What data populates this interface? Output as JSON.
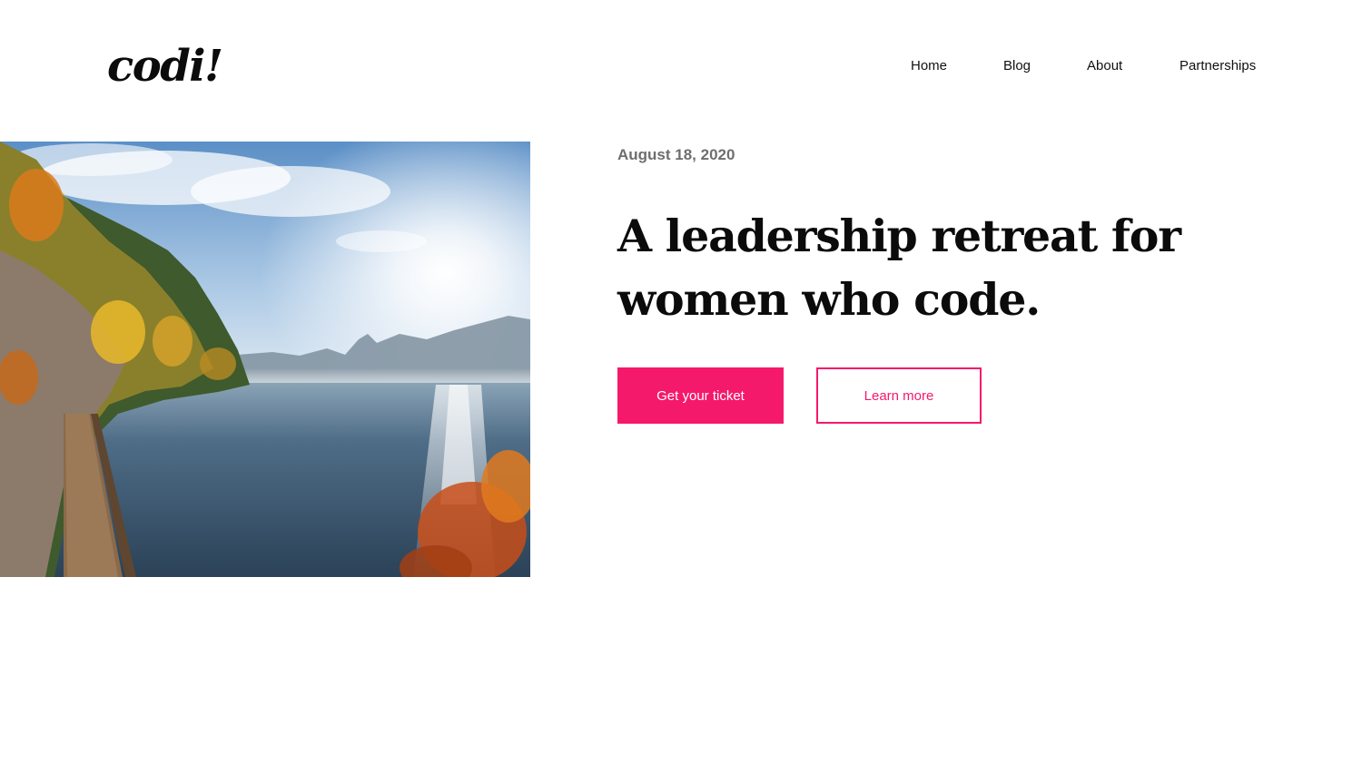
{
  "brand": {
    "logo_text": "codi!",
    "accent_color": "#f5196b"
  },
  "nav": {
    "items": [
      {
        "label": "Home"
      },
      {
        "label": "Blog"
      },
      {
        "label": "About"
      },
      {
        "label": "Partnerships"
      }
    ]
  },
  "hero": {
    "date": "August 18, 2020",
    "headline_line1": "A leadership retreat for",
    "headline_line2": "women who code.",
    "primary_button": "Get your ticket",
    "secondary_button": "Learn more",
    "image": "lake-autumn-landscape-photo"
  }
}
